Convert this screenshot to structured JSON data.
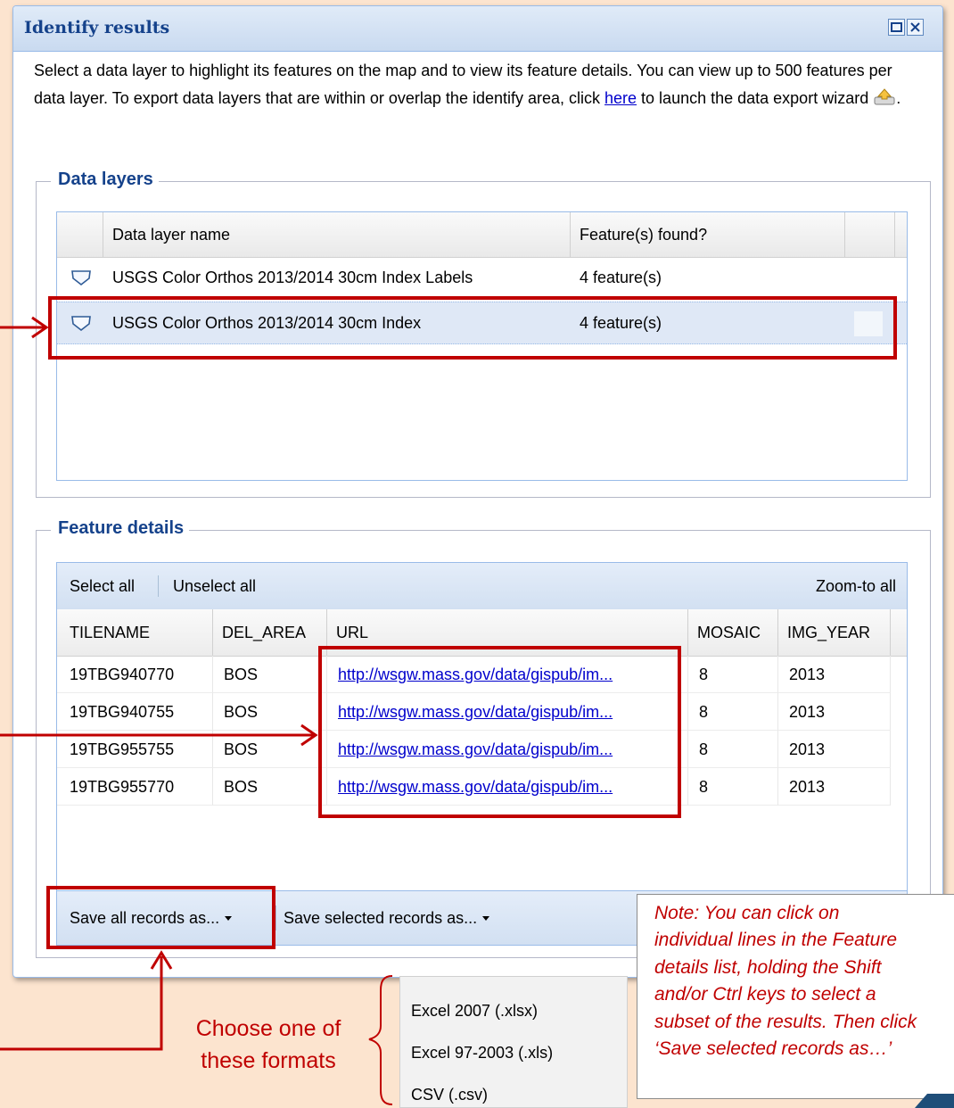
{
  "panel": {
    "title": "Identify results",
    "intro_text_1": "Select a data layer to highlight its features on the map and to view its feature details. You can view up to 500 features per data layer. To export data layers that are within or overlap the identify area, click ",
    "here_link": "here",
    "intro_text_2": " to launch the data export wizard ",
    "intro_text_3": "."
  },
  "data_layers": {
    "legend": "Data layers",
    "columns": [
      "Data layer name",
      "Feature(s) found?"
    ],
    "rows": [
      {
        "name": "USGS Color Orthos 2013/2014 30cm Index Labels",
        "found": "4 feature(s)"
      },
      {
        "name": "USGS Color Orthos 2013/2014 30cm Index",
        "found": "4 feature(s)"
      }
    ]
  },
  "feature_details": {
    "legend": "Feature details",
    "toolbar": {
      "select_all": "Select all",
      "unselect_all": "Unselect all",
      "zoom_all": "Zoom-to all"
    },
    "columns": [
      "TILENAME",
      "DEL_AREA",
      "URL",
      "MOSAIC",
      "IMG_YEAR"
    ],
    "rows": [
      {
        "tilename": "19TBG940770",
        "del_area": "BOS",
        "url": "http://wsgw.mass.gov/data/gispub/im...",
        "mosaic": "8",
        "img_year": "2013"
      },
      {
        "tilename": "19TBG940755",
        "del_area": "BOS",
        "url": "http://wsgw.mass.gov/data/gispub/im...",
        "mosaic": "8",
        "img_year": "2013"
      },
      {
        "tilename": "19TBG955755",
        "del_area": "BOS",
        "url": "http://wsgw.mass.gov/data/gispub/im...",
        "mosaic": "8",
        "img_year": "2013"
      },
      {
        "tilename": "19TBG955770",
        "del_area": "BOS",
        "url": "http://wsgw.mass.gov/data/gispub/im...",
        "mosaic": "8",
        "img_year": "2013"
      }
    ],
    "save_all": "Save all records as...",
    "save_selected": "Save selected records as..."
  },
  "export_menu": [
    "Excel 2007 (.xlsx)",
    "Excel 97-2003 (.xls)",
    "CSV (.csv)"
  ],
  "annotations": {
    "choose_line_1": "Choose one of",
    "choose_line_2": "these formats",
    "note_lines": [
      "Note: You can click on",
      "individual lines in the Feature",
      "details list, holding the Shift",
      "and/or Ctrl keys to select a",
      "subset of the results. Then click",
      "‘Save selected records as…’"
    ]
  },
  "colors": {
    "accent": "#15428b",
    "annotation_red": "#c00000",
    "link": "#0000cc",
    "selected_row": "#dfe8f6"
  },
  "icons": [
    "maximize-icon",
    "close-icon",
    "export-wizard-icon",
    "layer-shape-icon",
    "dropdown-caret-icon"
  ]
}
